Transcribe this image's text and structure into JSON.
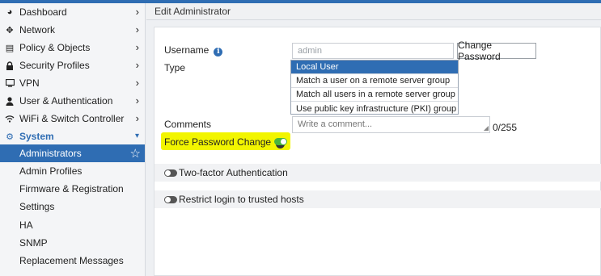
{
  "header": {
    "title": "Edit Administrator"
  },
  "sidebar": {
    "items": [
      {
        "label": "Dashboard",
        "icon": "dashboard-icon"
      },
      {
        "label": "Network",
        "icon": "network-icon"
      },
      {
        "label": "Policy & Objects",
        "icon": "policy-icon"
      },
      {
        "label": "Security Profiles",
        "icon": "lock-icon"
      },
      {
        "label": "VPN",
        "icon": "monitor-icon"
      },
      {
        "label": "User & Authentication",
        "icon": "user-icon"
      },
      {
        "label": "WiFi & Switch Controller",
        "icon": "wifi-icon"
      },
      {
        "label": "System",
        "icon": "gear-icon"
      }
    ],
    "subitems": [
      {
        "label": "Administrators"
      },
      {
        "label": "Admin Profiles"
      },
      {
        "label": "Firmware & Registration"
      },
      {
        "label": "Settings"
      },
      {
        "label": "HA"
      },
      {
        "label": "SNMP"
      },
      {
        "label": "Replacement Messages"
      }
    ]
  },
  "form": {
    "username_label": "Username",
    "username_value": "admin",
    "change_password": "Change Password",
    "type_label": "Type",
    "type_options": [
      "Local User",
      "Match a user on a remote server group",
      "Match all users in a remote server group",
      "Use public key infrastructure (PKI) group"
    ],
    "type_selected": "Local User",
    "comments_label": "Comments",
    "comments_placeholder": "Write a comment...",
    "comments_counter": "0/255",
    "force_password_label": "Force Password Change",
    "force_password_enabled": true
  },
  "sections": {
    "two_factor": "Two-factor Authentication",
    "restrict_login": "Restrict login to trusted hosts"
  },
  "colors": {
    "accent": "#2f6db3",
    "highlight": "#f2f500",
    "toggle_on": "#48b53e"
  }
}
